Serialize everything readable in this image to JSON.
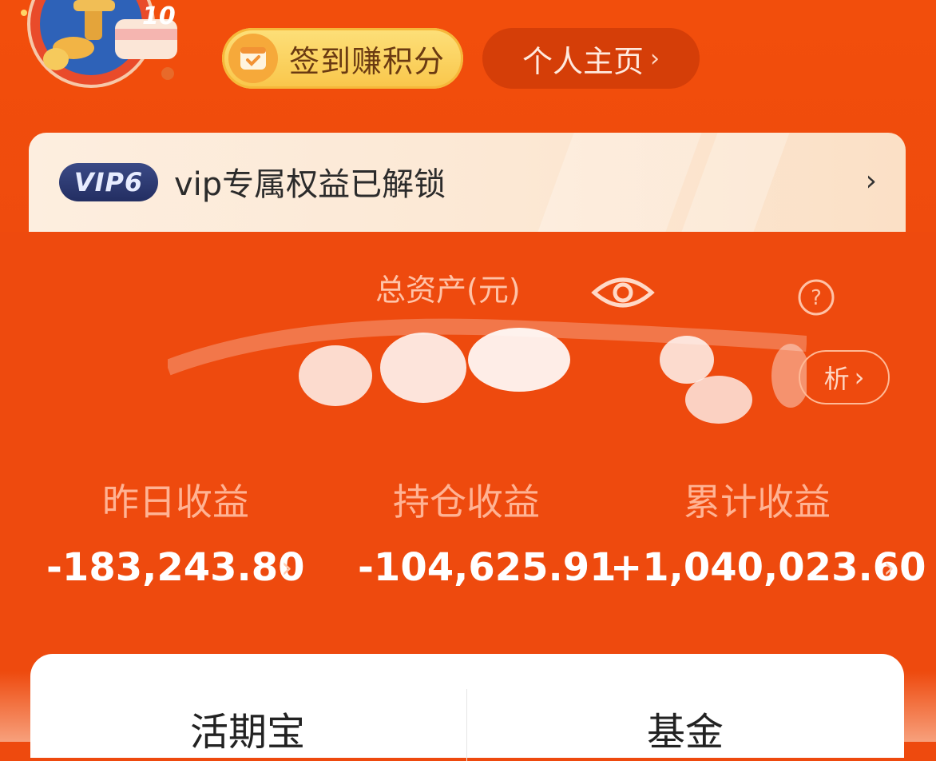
{
  "header": {
    "avatar_badge_number": "10",
    "sign_button_label": "签到赚积分",
    "profile_button_label": "个人主页",
    "profile_chevron": "›"
  },
  "vip": {
    "badge": "VIP6",
    "text": "vip专属权益已解锁",
    "chevron": "›"
  },
  "assets": {
    "title": "总资产(元)",
    "analysis_label": "析",
    "analysis_chevron": "›",
    "stats": [
      {
        "label": "昨日收益",
        "value": "-183,243.80",
        "chevron": "›"
      },
      {
        "label": "持仓收益",
        "value": "-104,625.91",
        "chevron": ""
      },
      {
        "label": "累计收益",
        "value": "+1,040,023.60",
        "chevron": "›"
      }
    ]
  },
  "tabs": [
    {
      "label": "活期宝"
    },
    {
      "label": "基金"
    }
  ],
  "colors": {
    "brand_orange": "#EE4A0E",
    "sign_yellow": "#F9C64A",
    "vip_navy": "#232E62"
  }
}
